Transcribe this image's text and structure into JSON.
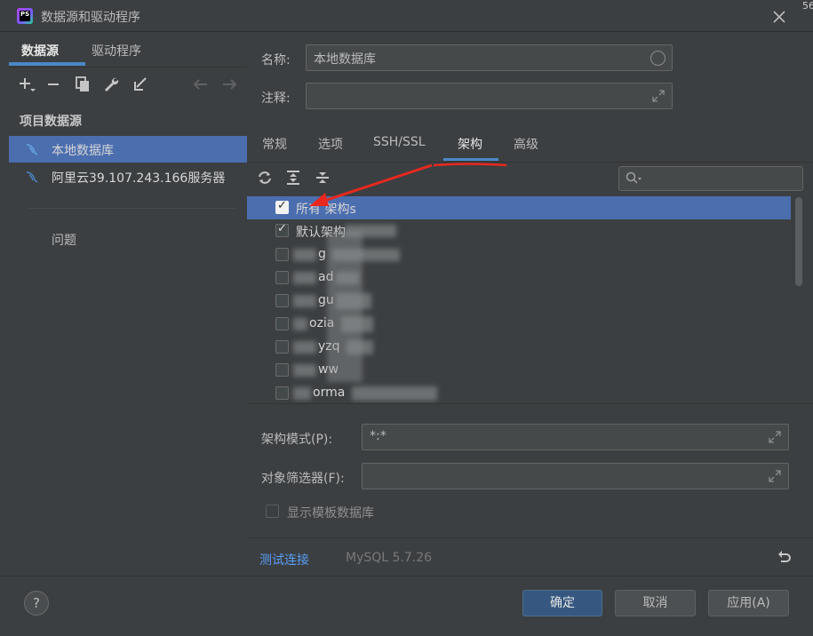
{
  "window": {
    "title": "数据源和驱动程序",
    "corner_fragment": "56"
  },
  "left": {
    "tabs": [
      "数据源",
      "驱动程序"
    ],
    "section_title": "项目数据源",
    "datasources": [
      {
        "label": "本地数据库",
        "selected": true
      },
      {
        "label": "阿里云39.107.243.166服务器",
        "selected": false
      }
    ],
    "problems": "问题"
  },
  "form": {
    "name_label": "名称:",
    "name_value": "本地数据库",
    "comment_label": "注释:",
    "comment_value": ""
  },
  "tabs": [
    "常规",
    "选项",
    "SSH/SSL",
    "架构",
    "高级"
  ],
  "active_tab": "架构",
  "schemas": [
    {
      "label": "所有 架构s",
      "checked": true
    },
    {
      "label": "默认架构",
      "checked": true
    },
    {
      "label": "g",
      "checked": false
    },
    {
      "label": "ad",
      "checked": false
    },
    {
      "label": "gu",
      "checked": false
    },
    {
      "label": "ozia",
      "checked": false
    },
    {
      "label": "yzq",
      "checked": false
    },
    {
      "label": "ww",
      "checked": false
    },
    {
      "label": "orma",
      "checked": false
    }
  ],
  "lower": {
    "pattern_label": "架构模式(P):",
    "pattern_value": "*:*",
    "filter_label": "对象筛选器(F):",
    "filter_value": "",
    "template_checkbox": "显示模板数据库",
    "test_link": "测试连接",
    "version": "MySQL 5.7.26"
  },
  "buttons": {
    "help": "?",
    "ok": "确定",
    "cancel": "取消",
    "apply": "应用(A)"
  },
  "colors": {
    "selection": "#4b6eaf",
    "accent": "#4a88c7",
    "annotation_red": "#e8281f",
    "link": "#589df6"
  }
}
